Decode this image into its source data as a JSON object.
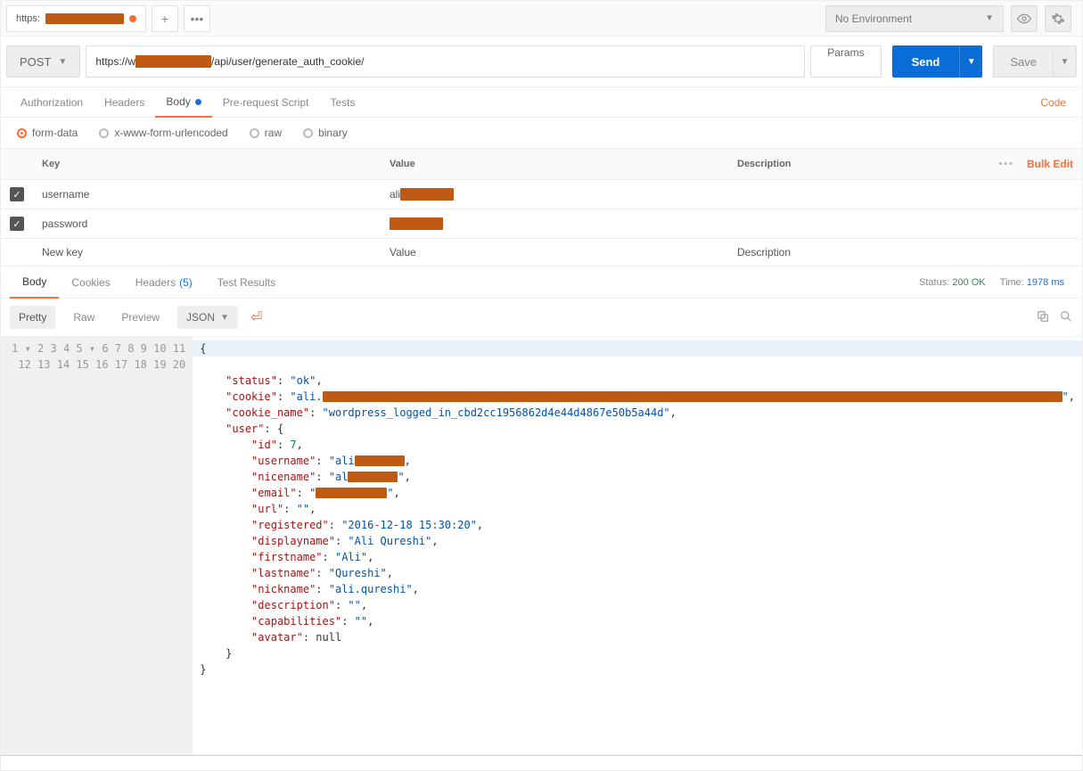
{
  "tab": {
    "prefix": "https:",
    "has_unsaved": true
  },
  "env": {
    "label": "No Environment"
  },
  "request": {
    "method": "POST",
    "url_prefix": "https://w",
    "url_suffix": "/api/user/generate_auth_cookie/",
    "params_btn": "Params",
    "send_btn": "Send",
    "save_btn": "Save",
    "tabs": [
      "Authorization",
      "Headers",
      "Body",
      "Pre-request Script",
      "Tests"
    ],
    "active_tab": "Body",
    "active_tab_dot": true,
    "code_link": "Code",
    "body_types": [
      "form-data",
      "x-www-form-urlencoded",
      "raw",
      "binary"
    ],
    "body_type_selected": "form-data",
    "kv_headers": {
      "key": "Key",
      "value": "Value",
      "desc": "Description"
    },
    "rows": [
      {
        "checked": true,
        "key": "username",
        "value_prefix": "ali"
      },
      {
        "checked": true,
        "key": "password",
        "value_prefix": ""
      }
    ],
    "new_row": {
      "key": "New key",
      "value": "Value",
      "desc": "Description"
    },
    "bulk_edit": "Bulk Edit"
  },
  "response": {
    "tabs": {
      "body": "Body",
      "cookies": "Cookies",
      "headers": "Headers",
      "headers_count": "(5)",
      "tests": "Test Results"
    },
    "status_label": "Status:",
    "status_value": "200 OK",
    "time_label": "Time:",
    "time_value": "1978 ms",
    "views": {
      "pretty": "Pretty",
      "raw": "Raw",
      "preview": "Preview"
    },
    "format": "JSON",
    "json": {
      "status": "ok",
      "cookie_prefix": "ali.",
      "cookie_name": "wordpress_logged_in_cbd2cc1956862d4e44d4867e50b5a44d",
      "user": {
        "id": 7,
        "username_prefix": "ali",
        "nicename_prefix": "al",
        "email_prefix": "",
        "url": "",
        "registered": "2016-12-18 15:30:20",
        "displayname": "Ali Qureshi",
        "firstname": "Ali",
        "lastname": "Qureshi",
        "nickname": "ali.qureshi",
        "description": "",
        "capabilities": "",
        "avatar": null
      }
    }
  }
}
